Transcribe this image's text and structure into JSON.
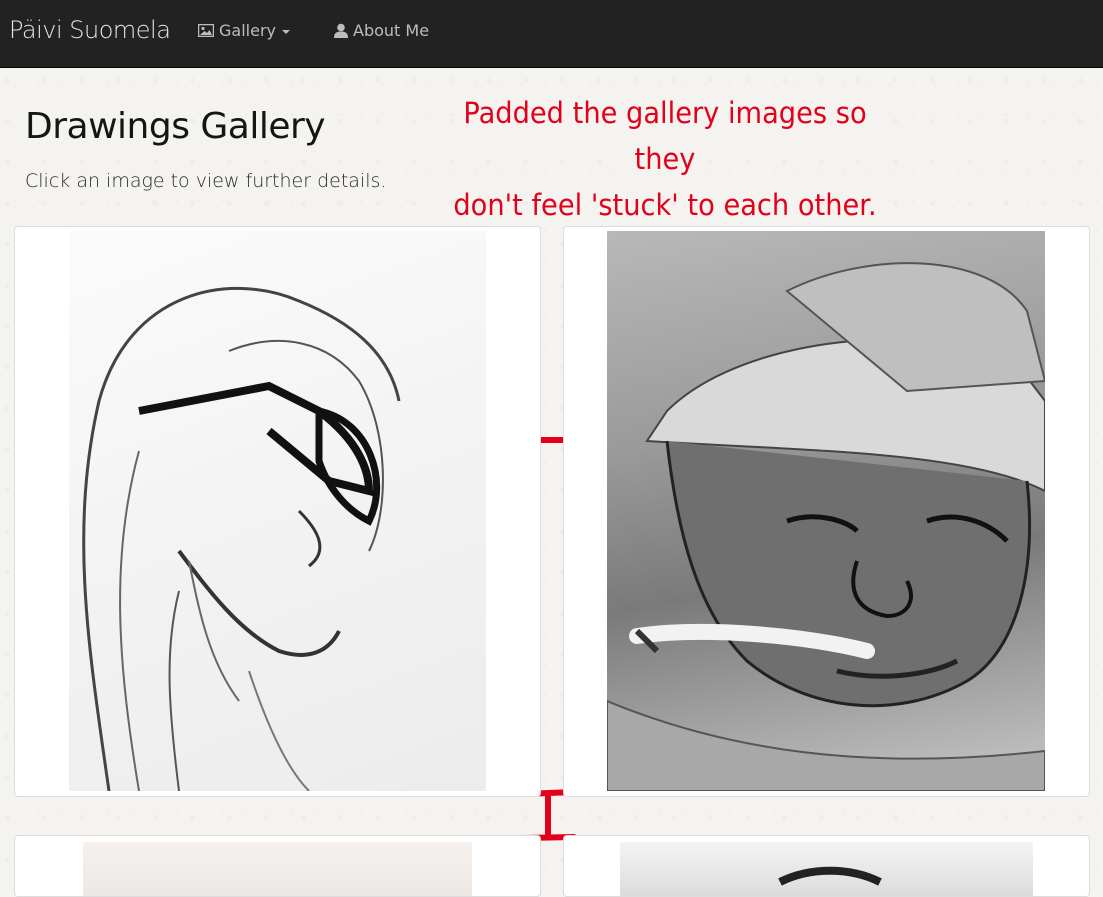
{
  "navbar": {
    "brand": "Päivi Suomela",
    "gallery_label": "Gallery",
    "about_label": "About Me",
    "gallery_icon": "picture-icon",
    "about_icon": "user-icon"
  },
  "page": {
    "title": "Drawings Gallery",
    "subtitle": "Click an image to view further details."
  },
  "annotation": {
    "line1": "Padded the gallery images so they",
    "line2": "don't feel 'stuck' to each other.",
    "color": "#e2001a"
  },
  "gallery": {
    "items": [
      {
        "alt": "Pencil portrait of man with long hair and glasses"
      },
      {
        "alt": "Pencil portrait of man in cap with cigarette"
      },
      {
        "alt": "Drawing thumbnail 3"
      },
      {
        "alt": "Drawing thumbnail 4"
      }
    ]
  }
}
